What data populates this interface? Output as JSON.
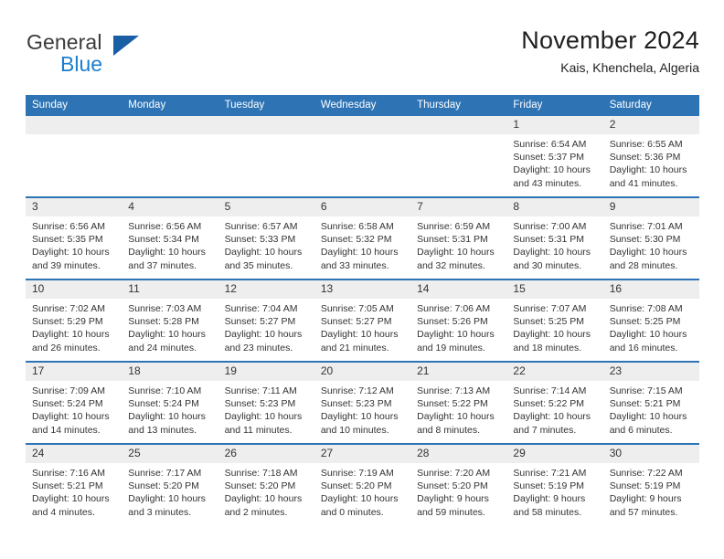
{
  "brand": {
    "word_general": "General",
    "word_blue": "Blue",
    "triangle_color": "#1a5fa6",
    "blue_color": "#1b7fd1"
  },
  "header": {
    "title": "November 2024",
    "subtitle": "Kais, Khenchela, Algeria"
  },
  "theme": {
    "header_blue": "#2e74b5",
    "daynum_band": "#eeeeee",
    "text": "#333333"
  },
  "calendar": {
    "weekday_headers": [
      "Sunday",
      "Monday",
      "Tuesday",
      "Wednesday",
      "Thursday",
      "Friday",
      "Saturday"
    ],
    "weeks": [
      [
        {
          "day": "",
          "empty": true
        },
        {
          "day": "",
          "empty": true
        },
        {
          "day": "",
          "empty": true
        },
        {
          "day": "",
          "empty": true
        },
        {
          "day": "",
          "empty": true
        },
        {
          "day": "1",
          "sunrise": "Sunrise: 6:54 AM",
          "sunset": "Sunset: 5:37 PM",
          "daylight": "Daylight: 10 hours and 43 minutes."
        },
        {
          "day": "2",
          "sunrise": "Sunrise: 6:55 AM",
          "sunset": "Sunset: 5:36 PM",
          "daylight": "Daylight: 10 hours and 41 minutes."
        }
      ],
      [
        {
          "day": "3",
          "sunrise": "Sunrise: 6:56 AM",
          "sunset": "Sunset: 5:35 PM",
          "daylight": "Daylight: 10 hours and 39 minutes."
        },
        {
          "day": "4",
          "sunrise": "Sunrise: 6:56 AM",
          "sunset": "Sunset: 5:34 PM",
          "daylight": "Daylight: 10 hours and 37 minutes."
        },
        {
          "day": "5",
          "sunrise": "Sunrise: 6:57 AM",
          "sunset": "Sunset: 5:33 PM",
          "daylight": "Daylight: 10 hours and 35 minutes."
        },
        {
          "day": "6",
          "sunrise": "Sunrise: 6:58 AM",
          "sunset": "Sunset: 5:32 PM",
          "daylight": "Daylight: 10 hours and 33 minutes."
        },
        {
          "day": "7",
          "sunrise": "Sunrise: 6:59 AM",
          "sunset": "Sunset: 5:31 PM",
          "daylight": "Daylight: 10 hours and 32 minutes."
        },
        {
          "day": "8",
          "sunrise": "Sunrise: 7:00 AM",
          "sunset": "Sunset: 5:31 PM",
          "daylight": "Daylight: 10 hours and 30 minutes."
        },
        {
          "day": "9",
          "sunrise": "Sunrise: 7:01 AM",
          "sunset": "Sunset: 5:30 PM",
          "daylight": "Daylight: 10 hours and 28 minutes."
        }
      ],
      [
        {
          "day": "10",
          "sunrise": "Sunrise: 7:02 AM",
          "sunset": "Sunset: 5:29 PM",
          "daylight": "Daylight: 10 hours and 26 minutes."
        },
        {
          "day": "11",
          "sunrise": "Sunrise: 7:03 AM",
          "sunset": "Sunset: 5:28 PM",
          "daylight": "Daylight: 10 hours and 24 minutes."
        },
        {
          "day": "12",
          "sunrise": "Sunrise: 7:04 AM",
          "sunset": "Sunset: 5:27 PM",
          "daylight": "Daylight: 10 hours and 23 minutes."
        },
        {
          "day": "13",
          "sunrise": "Sunrise: 7:05 AM",
          "sunset": "Sunset: 5:27 PM",
          "daylight": "Daylight: 10 hours and 21 minutes."
        },
        {
          "day": "14",
          "sunrise": "Sunrise: 7:06 AM",
          "sunset": "Sunset: 5:26 PM",
          "daylight": "Daylight: 10 hours and 19 minutes."
        },
        {
          "day": "15",
          "sunrise": "Sunrise: 7:07 AM",
          "sunset": "Sunset: 5:25 PM",
          "daylight": "Daylight: 10 hours and 18 minutes."
        },
        {
          "day": "16",
          "sunrise": "Sunrise: 7:08 AM",
          "sunset": "Sunset: 5:25 PM",
          "daylight": "Daylight: 10 hours and 16 minutes."
        }
      ],
      [
        {
          "day": "17",
          "sunrise": "Sunrise: 7:09 AM",
          "sunset": "Sunset: 5:24 PM",
          "daylight": "Daylight: 10 hours and 14 minutes."
        },
        {
          "day": "18",
          "sunrise": "Sunrise: 7:10 AM",
          "sunset": "Sunset: 5:24 PM",
          "daylight": "Daylight: 10 hours and 13 minutes."
        },
        {
          "day": "19",
          "sunrise": "Sunrise: 7:11 AM",
          "sunset": "Sunset: 5:23 PM",
          "daylight": "Daylight: 10 hours and 11 minutes."
        },
        {
          "day": "20",
          "sunrise": "Sunrise: 7:12 AM",
          "sunset": "Sunset: 5:23 PM",
          "daylight": "Daylight: 10 hours and 10 minutes."
        },
        {
          "day": "21",
          "sunrise": "Sunrise: 7:13 AM",
          "sunset": "Sunset: 5:22 PM",
          "daylight": "Daylight: 10 hours and 8 minutes."
        },
        {
          "day": "22",
          "sunrise": "Sunrise: 7:14 AM",
          "sunset": "Sunset: 5:22 PM",
          "daylight": "Daylight: 10 hours and 7 minutes."
        },
        {
          "day": "23",
          "sunrise": "Sunrise: 7:15 AM",
          "sunset": "Sunset: 5:21 PM",
          "daylight": "Daylight: 10 hours and 6 minutes."
        }
      ],
      [
        {
          "day": "24",
          "sunrise": "Sunrise: 7:16 AM",
          "sunset": "Sunset: 5:21 PM",
          "daylight": "Daylight: 10 hours and 4 minutes."
        },
        {
          "day": "25",
          "sunrise": "Sunrise: 7:17 AM",
          "sunset": "Sunset: 5:20 PM",
          "daylight": "Daylight: 10 hours and 3 minutes."
        },
        {
          "day": "26",
          "sunrise": "Sunrise: 7:18 AM",
          "sunset": "Sunset: 5:20 PM",
          "daylight": "Daylight: 10 hours and 2 minutes."
        },
        {
          "day": "27",
          "sunrise": "Sunrise: 7:19 AM",
          "sunset": "Sunset: 5:20 PM",
          "daylight": "Daylight: 10 hours and 0 minutes."
        },
        {
          "day": "28",
          "sunrise": "Sunrise: 7:20 AM",
          "sunset": "Sunset: 5:20 PM",
          "daylight": "Daylight: 9 hours and 59 minutes."
        },
        {
          "day": "29",
          "sunrise": "Sunrise: 7:21 AM",
          "sunset": "Sunset: 5:19 PM",
          "daylight": "Daylight: 9 hours and 58 minutes."
        },
        {
          "day": "30",
          "sunrise": "Sunrise: 7:22 AM",
          "sunset": "Sunset: 5:19 PM",
          "daylight": "Daylight: 9 hours and 57 minutes."
        }
      ]
    ]
  }
}
